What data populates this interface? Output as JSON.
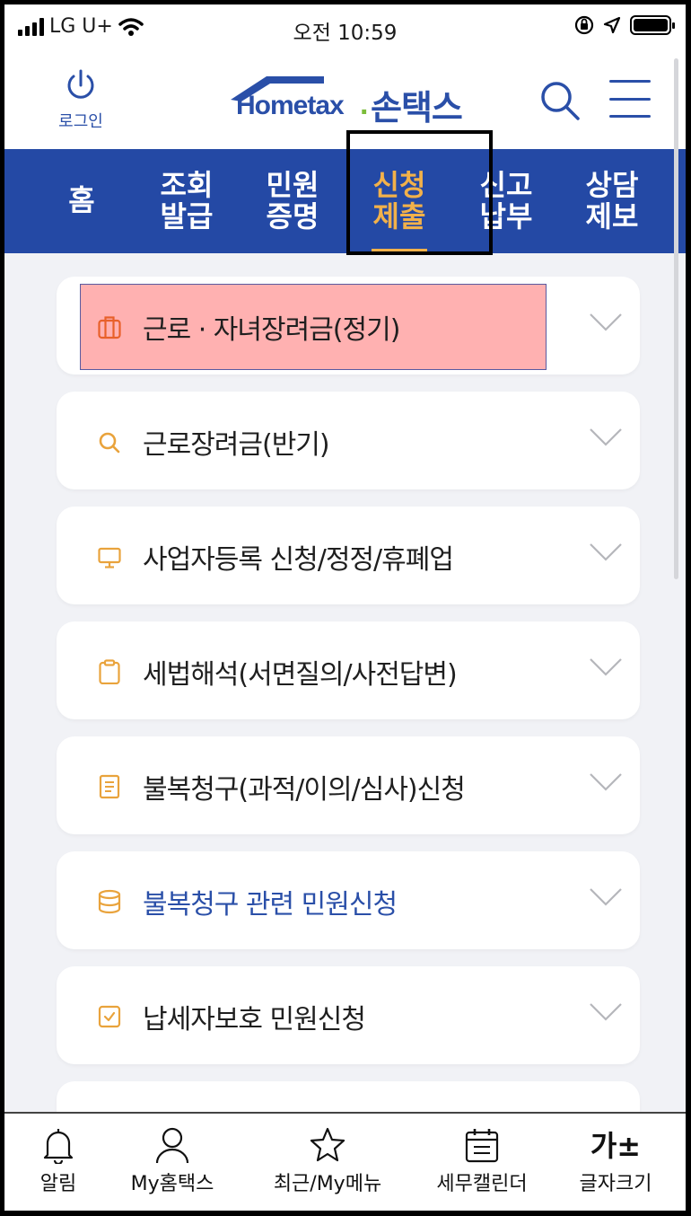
{
  "status_bar": {
    "carrier": "LG U+",
    "time": "오전 10:59"
  },
  "header": {
    "login_label": "로그인",
    "logo_en": "Hometax",
    "logo_ko": "손택스"
  },
  "nav": {
    "tabs": [
      {
        "line1": "홈",
        "line2": "",
        "active": false
      },
      {
        "line1": "조회",
        "line2": "발급",
        "active": false
      },
      {
        "line1": "민원",
        "line2": "증명",
        "active": false
      },
      {
        "line1": "신청",
        "line2": "제출",
        "active": true
      },
      {
        "line1": "신고",
        "line2": "납부",
        "active": false
      },
      {
        "line1": "상담",
        "line2": "제보",
        "active": false
      }
    ]
  },
  "menu_items": [
    {
      "label": "근로 · 자녀장려금(정기)",
      "icon": "briefcase-icon",
      "color": "#e8602a",
      "highlighted": true
    },
    {
      "label": "근로장려금(반기)",
      "icon": "search-icon",
      "color": "#e9a33c"
    },
    {
      "label": "사업자등록 신청/정정/휴폐업",
      "icon": "monitor-icon",
      "color": "#e9a33c"
    },
    {
      "label": "세법해석(서면질의/사전답변)",
      "icon": "clipboard-icon",
      "color": "#e9a33c"
    },
    {
      "label": "불복청구(과적/이의/심사)신청",
      "icon": "document-icon",
      "color": "#e9a33c"
    },
    {
      "label": "불복청구 관련 민원신청",
      "icon": "database-icon",
      "color": "#e9a33c",
      "blue": true
    },
    {
      "label": "납세자보호 민원신청",
      "icon": "checkbox-icon",
      "color": "#e9a33c"
    }
  ],
  "bottom_bar": {
    "items": [
      {
        "label": "알림",
        "icon": "bell-icon"
      },
      {
        "label": "My홈택스",
        "icon": "person-icon"
      },
      {
        "label": "최근/My메뉴",
        "icon": "star-icon"
      },
      {
        "label": "세무캘린더",
        "icon": "calendar-icon"
      },
      {
        "label": "글자크기",
        "icon": "font-size-icon",
        "glyph": "가±"
      }
    ]
  },
  "colors": {
    "brand_blue": "#2449a5",
    "accent_orange": "#f2b14a",
    "highlight": "#ffb1b1"
  }
}
